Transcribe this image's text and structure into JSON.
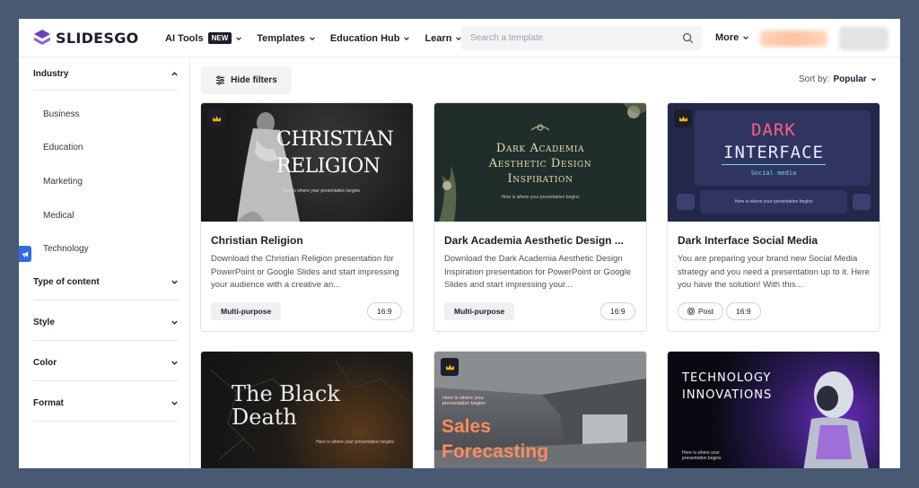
{
  "header": {
    "logo_text": "SLIDESGO",
    "nav": [
      {
        "label": "AI Tools",
        "badge": "NEW"
      },
      {
        "label": "Templates"
      },
      {
        "label": "Education Hub"
      },
      {
        "label": "Learn"
      }
    ],
    "search_placeholder": "Search a template",
    "more_label": "More"
  },
  "sidebar": {
    "industry_label": "Industry",
    "industry_items": [
      "Business",
      "Education",
      "Marketing",
      "Medical",
      "Technology"
    ],
    "sections": [
      "Type of content",
      "Style",
      "Color",
      "Format"
    ]
  },
  "toolbar": {
    "hide_filters_label": "Hide filters",
    "sort_label": "Sort by:",
    "sort_value": "Popular"
  },
  "cards": [
    {
      "title": "Christian Religion",
      "description": "Download the Christian Religion presentation for PowerPoint or Google Slides and start impressing your audience with a creative an...",
      "tags": [
        "Multi-purpose",
        "16:9"
      ],
      "thumb_title_line1": "CHRISTIAN",
      "thumb_title_line2": "RELIGION",
      "thumb_sub": "Here is where your presentation begins"
    },
    {
      "title": "Dark Academia Aesthetic Design ...",
      "description": "Download the Dark Academia Aesthetic Design Inspiration presentation for PowerPoint or Google Slides and start impressing your...",
      "tags": [
        "Multi-purpose",
        "16:9"
      ],
      "thumb_title_line1": "Dark Academia",
      "thumb_title_line2": "Aesthetic Design",
      "thumb_title_line3": "Inspiration",
      "thumb_sub": "Here is where your presentation begins"
    },
    {
      "title": "Dark Interface Social Media",
      "description": "You are preparing your brand new Social Media strategy and you need a presentation up to it. Here you have the solution! With this...",
      "tags": [
        "Post",
        "16:9"
      ],
      "thumb_title_line1": "DARK",
      "thumb_title_line2": "INTERFACE",
      "thumb_sub2": "Social media",
      "thumb_sub": "Here is where your presentation begins"
    },
    {
      "thumb_title_line1": "The Black",
      "thumb_title_line2": "Death",
      "thumb_sub": "Here is where your presentation begins"
    },
    {
      "thumb_sub": "Here is where your presentation begins",
      "thumb_title_line1": "Sales",
      "thumb_title_line2": "Forecasting"
    },
    {
      "thumb_title_line1": "TECHNOLOGY",
      "thumb_title_line2": "INNOVATIONS",
      "thumb_sub": "Here is where your presentation begins"
    }
  ],
  "colors": {
    "accent_blue": "#2f6be4",
    "logo_purple": "#6b3fc4",
    "crown_gold": "#f5b400",
    "sales_orange": "#ff8a5c"
  }
}
